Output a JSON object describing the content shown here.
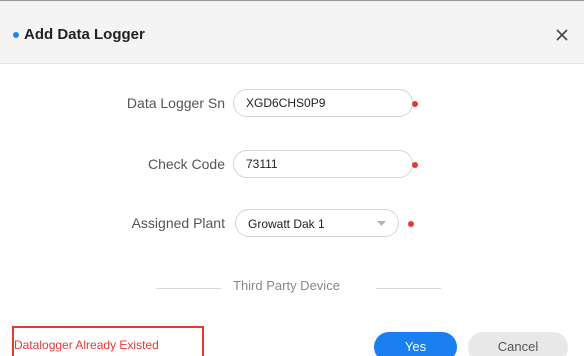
{
  "dialog": {
    "title": "Add Data Logger",
    "close_icon": "close-icon"
  },
  "form": {
    "logger_sn": {
      "label": "Data Logger Sn",
      "value": "XGD6CHS0P9"
    },
    "check_code": {
      "label": "Check Code",
      "value": "73111"
    },
    "assigned_plant": {
      "label": "Assigned Plant",
      "selected": "Growatt Dak 1",
      "icon": "chevron-down-icon"
    },
    "third_party_label": "Third Party Device"
  },
  "footer": {
    "error_message": "Datalogger Already Existed",
    "yes_label": "Yes",
    "cancel_label": "Cancel"
  },
  "colors": {
    "accent": "#1a7ff0",
    "required": "#e53935",
    "error": "#e53935"
  }
}
